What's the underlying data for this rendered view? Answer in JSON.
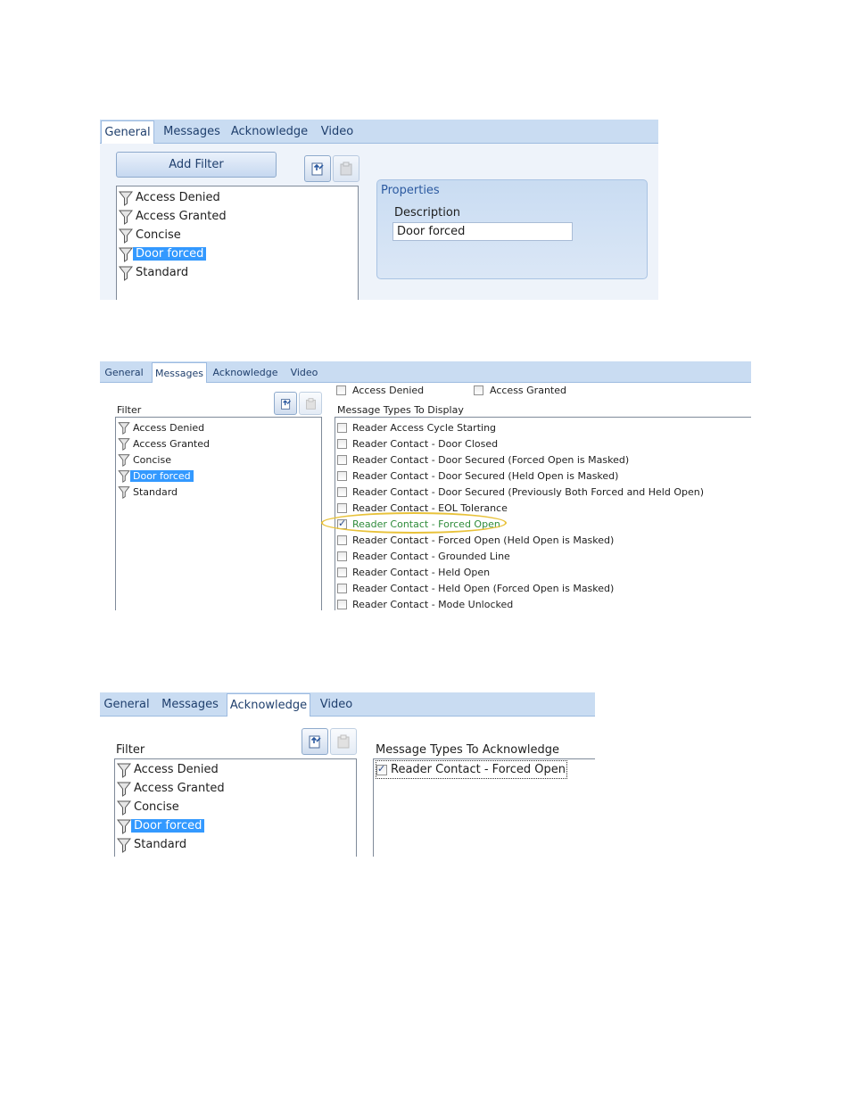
{
  "shot1": {
    "tabs": [
      "General",
      "Messages",
      "Acknowledge",
      "Video"
    ],
    "active_tab": 0,
    "add_filter_label": "Add Filter",
    "export_icon": "export-icon",
    "paste_icon": "paste-icon",
    "filters": [
      "Access Denied",
      "Access Granted",
      "Concise",
      "Door forced",
      "Standard"
    ],
    "selected_filter": 3,
    "properties": {
      "title": "Properties",
      "description_label": "Description",
      "description_value": "Door forced"
    }
  },
  "shot2": {
    "tabs": [
      "General",
      "Messages",
      "Acknowledge",
      "Video"
    ],
    "active_tab": 1,
    "filter_label": "Filter",
    "filters": [
      "Access Denied",
      "Access Granted",
      "Concise",
      "Door forced",
      "Standard"
    ],
    "selected_filter": 3,
    "top_checks": [
      {
        "label": "Access Denied",
        "checked": false
      },
      {
        "label": "Access Granted",
        "checked": false
      }
    ],
    "message_types_label": "Message Types To Display",
    "message_types": [
      {
        "label": "Reader Access Cycle Starting",
        "checked": false
      },
      {
        "label": "Reader Contact - Door Closed",
        "checked": false
      },
      {
        "label": "Reader Contact - Door Secured (Forced Open is Masked)",
        "checked": false
      },
      {
        "label": "Reader Contact - Door Secured (Held Open is Masked)",
        "checked": false
      },
      {
        "label": "Reader Contact - Door Secured (Previously Both Forced and Held Open)",
        "checked": false
      },
      {
        "label": "Reader Contact - EOL Tolerance",
        "checked": false
      },
      {
        "label": "Reader Contact - Forced Open",
        "checked": true
      },
      {
        "label": "Reader Contact - Forced Open (Held Open is Masked)",
        "checked": false
      },
      {
        "label": "Reader Contact - Grounded Line",
        "checked": false
      },
      {
        "label": "Reader Contact - Held Open",
        "checked": false
      },
      {
        "label": "Reader Contact - Held Open (Forced Open is Masked)",
        "checked": false
      },
      {
        "label": "Reader Contact - Mode Unlocked",
        "checked": false
      }
    ],
    "highlight_color": "#e8c23a",
    "checked_text_color": "#2e8b3a"
  },
  "shot3": {
    "tabs": [
      "General",
      "Messages",
      "Acknowledge",
      "Video"
    ],
    "active_tab": 2,
    "filter_label": "Filter",
    "filters": [
      "Access Denied",
      "Access Granted",
      "Concise",
      "Door forced",
      "Standard"
    ],
    "selected_filter": 3,
    "ack_label": "Message Types To Acknowledge",
    "ack_types": [
      {
        "label": "Reader Contact - Forced Open",
        "checked": true
      }
    ]
  }
}
